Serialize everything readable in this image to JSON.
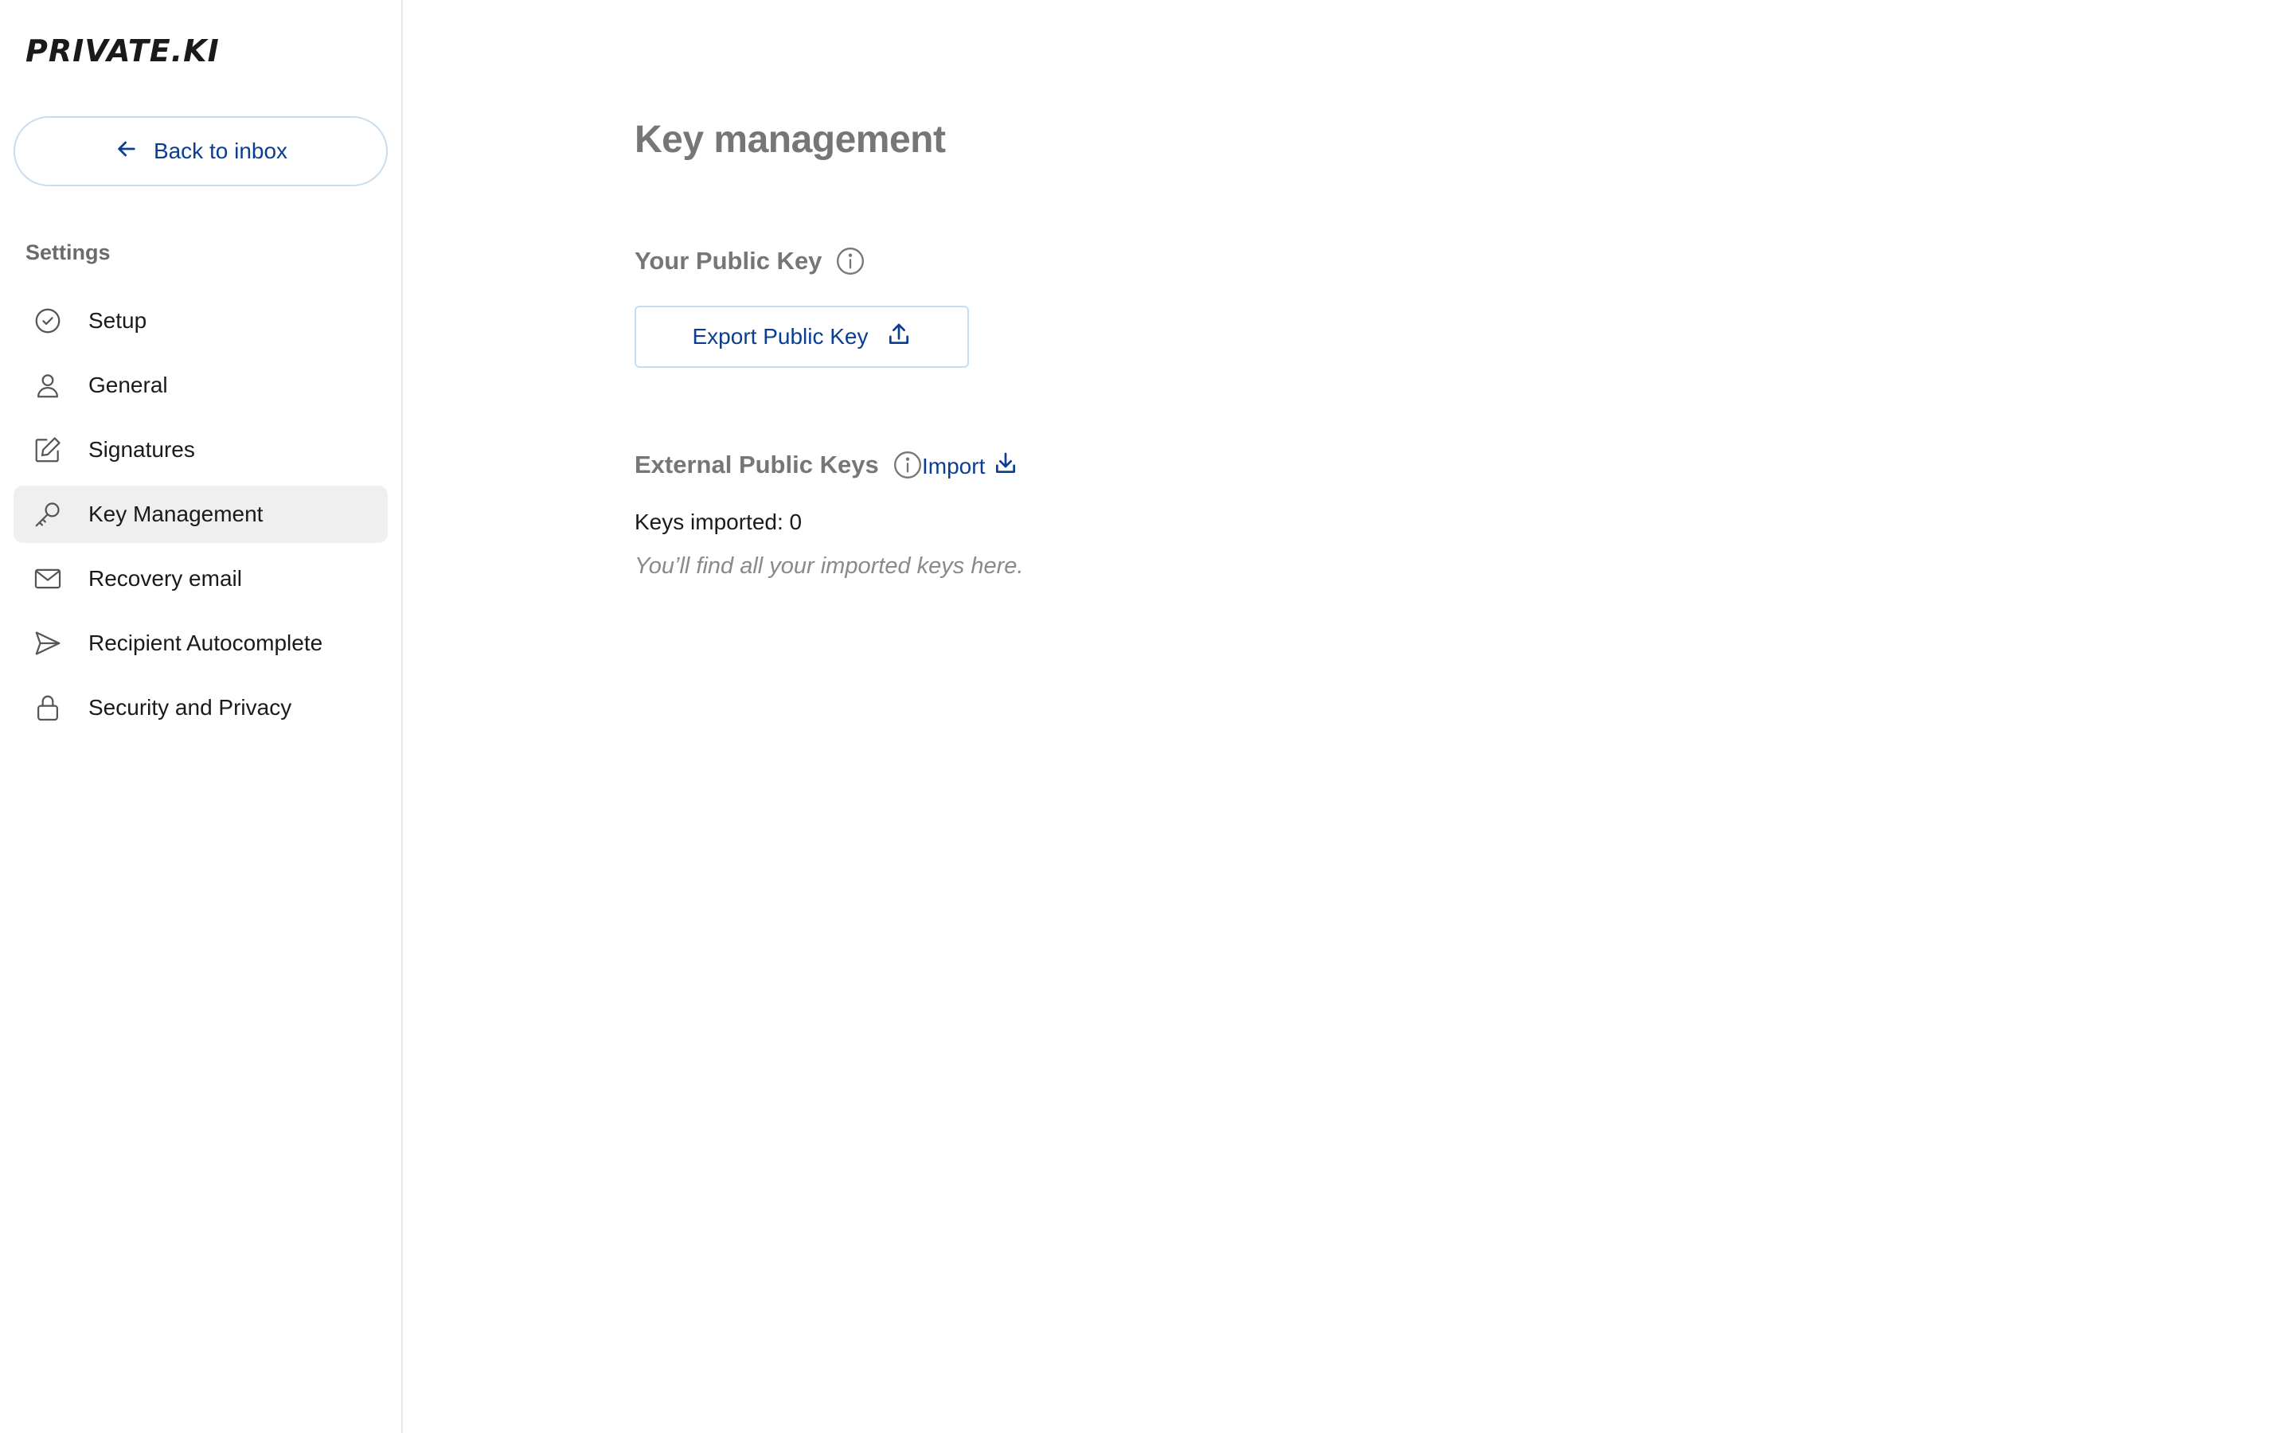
{
  "brand": {
    "logo_text": "PRIVATE.KI"
  },
  "sidebar": {
    "back_label": "Back to inbox",
    "settings_heading": "Settings",
    "items": [
      {
        "label": "Setup",
        "icon": "check-circle-icon",
        "active": false
      },
      {
        "label": "General",
        "icon": "user-icon",
        "active": false
      },
      {
        "label": "Signatures",
        "icon": "pencil-icon",
        "active": false
      },
      {
        "label": "Key Management",
        "icon": "key-icon",
        "active": true
      },
      {
        "label": "Recovery email",
        "icon": "envelope-icon",
        "active": false
      },
      {
        "label": "Recipient Autocomplete",
        "icon": "send-icon",
        "active": false
      },
      {
        "label": "Security and Privacy",
        "icon": "lock-icon",
        "active": false
      }
    ]
  },
  "main": {
    "title": "Key management",
    "public_key": {
      "heading": "Your Public Key",
      "export_label": "Export Public Key"
    },
    "external_keys": {
      "heading": "External Public Keys",
      "import_label": "Import",
      "count_text": "Keys imported: 0",
      "empty_hint": "You’ll find all your imported keys here."
    }
  },
  "colors": {
    "accent": "#0b3d91",
    "button_border": "#c9ddf0",
    "muted_heading": "#767676",
    "active_item_bg": "#efefef"
  }
}
